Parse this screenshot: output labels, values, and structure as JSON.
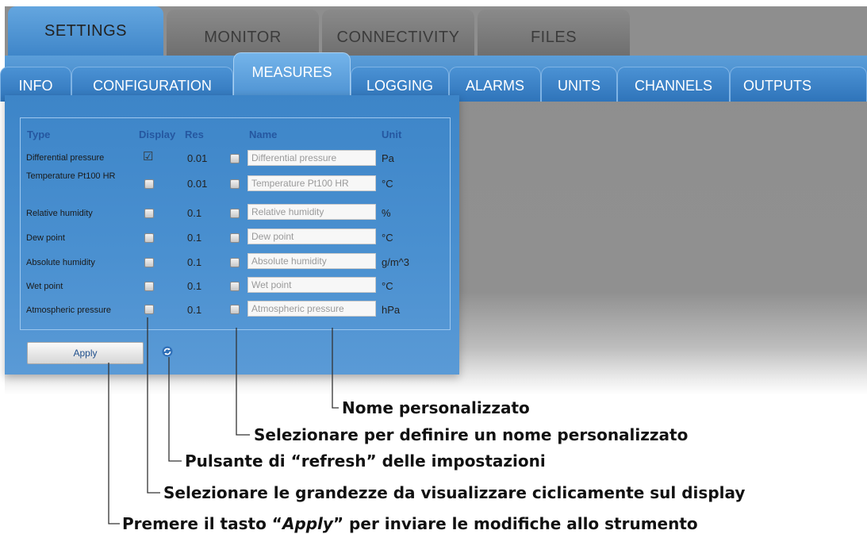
{
  "top_tabs": [
    "SETTINGS",
    "MONITOR",
    "CONNECTIVITY",
    "FILES"
  ],
  "sub_tabs": [
    "INFO",
    "CONFIGURATION",
    "MEASURES",
    "LOGGING",
    "ALARMS",
    "UNITS",
    "CHANNELS",
    "OUTPUTS"
  ],
  "table": {
    "headers": {
      "type": "Type",
      "display": "Display",
      "res": "Res",
      "name": "Name",
      "unit": "Unit"
    },
    "rows": [
      {
        "type": "Differential pressure",
        "display_checked": true,
        "res": "0.01",
        "name_checked": false,
        "name": "Differential pressure",
        "unit": "Pa"
      },
      {
        "type": "Temperature Pt100 HR",
        "display_checked": false,
        "res": "0.01",
        "name_checked": false,
        "name": "Temperature Pt100 HR",
        "unit": "°C"
      },
      {
        "type": "Relative humidity",
        "display_checked": false,
        "res": "0.1",
        "name_checked": false,
        "name": "Relative humidity",
        "unit": "%"
      },
      {
        "type": "Dew point",
        "display_checked": false,
        "res": "0.1",
        "name_checked": false,
        "name": "Dew point",
        "unit": "°C"
      },
      {
        "type": "Absolute humidity",
        "display_checked": false,
        "res": "0.1",
        "name_checked": false,
        "name": "Absolute humidity",
        "unit": "g/m^3"
      },
      {
        "type": "Wet point",
        "display_checked": false,
        "res": "0.1",
        "name_checked": false,
        "name": "Wet point",
        "unit": "°C"
      },
      {
        "type": "Atmospheric pressure",
        "display_checked": false,
        "res": "0.1",
        "name_checked": false,
        "name": "Atmospheric pressure",
        "unit": "hPa"
      }
    ]
  },
  "apply_label": "Apply",
  "icons": {
    "refresh": "refresh-icon",
    "check": "check-icon"
  },
  "colors": {
    "tab_blue": "#3a7fc3",
    "panel_blue": "#4a90d0",
    "header_text": "#2557a0"
  },
  "callouts": {
    "custom_name": "Nome personalizzato",
    "select_custom_name": "Selezionare per definire un nome personalizzato",
    "refresh_settings": "Pulsante di “refresh” delle impostazioni",
    "select_display": "Selezionare le grandezze da visualizzare ciclicamente sul display",
    "apply_pre": "Premere il tasto “",
    "apply_word": "Apply",
    "apply_post": "” per inviare le modifiche allo strumento"
  }
}
